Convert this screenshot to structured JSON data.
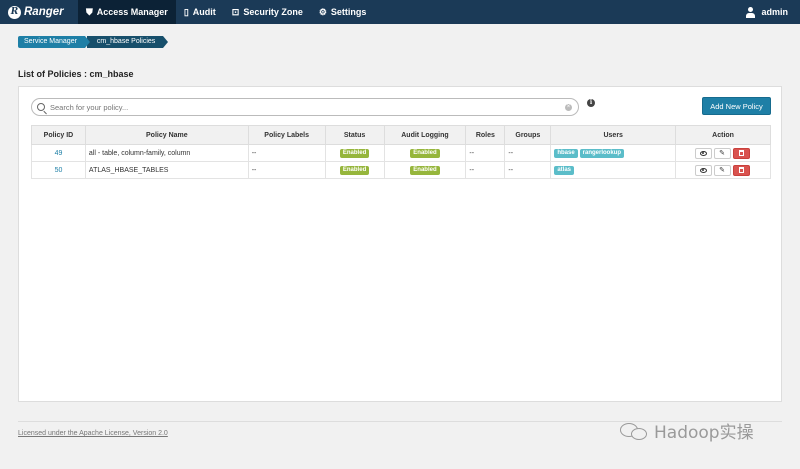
{
  "nav": {
    "brand": "Ranger",
    "brand_icon": "ranger-logo-icon",
    "items": [
      {
        "label": "Access Manager",
        "icon": "shield-icon"
      },
      {
        "label": "Audit",
        "icon": "file-icon"
      },
      {
        "label": "Security Zone",
        "icon": "zone-icon"
      },
      {
        "label": "Settings",
        "icon": "gear-icon"
      }
    ],
    "user": "admin"
  },
  "breadcrumb": [
    "Service Manager",
    "cm_hbase Policies"
  ],
  "page_title": "List of Policies : cm_hbase",
  "search": {
    "placeholder": "Search for your policy..."
  },
  "add_button": "Add New Policy",
  "table": {
    "headers": [
      "Policy ID",
      "Policy Name",
      "Policy Labels",
      "Status",
      "Audit Logging",
      "Roles",
      "Groups",
      "Users",
      "Action"
    ],
    "rows": [
      {
        "id": "49",
        "name": "all - table, column-family, column",
        "labels": "--",
        "status": "Enabled",
        "audit": "Enabled",
        "roles": "--",
        "groups": "--",
        "users": [
          "hbase",
          "rangerlookup"
        ]
      },
      {
        "id": "50",
        "name": "ATLAS_HBASE_TABLES",
        "labels": "--",
        "status": "Enabled",
        "audit": "Enabled",
        "roles": "--",
        "groups": "--",
        "users": [
          "atlas"
        ]
      }
    ]
  },
  "footer": "Licensed under the Apache License, Version 2.0",
  "watermark": "Hadoop实操",
  "colors": {
    "navbar": "#1b3a57",
    "accent": "#1e7fa6",
    "enabled": "#96b63c",
    "user_tag": "#5bbdc9",
    "delete": "#d9534f"
  }
}
